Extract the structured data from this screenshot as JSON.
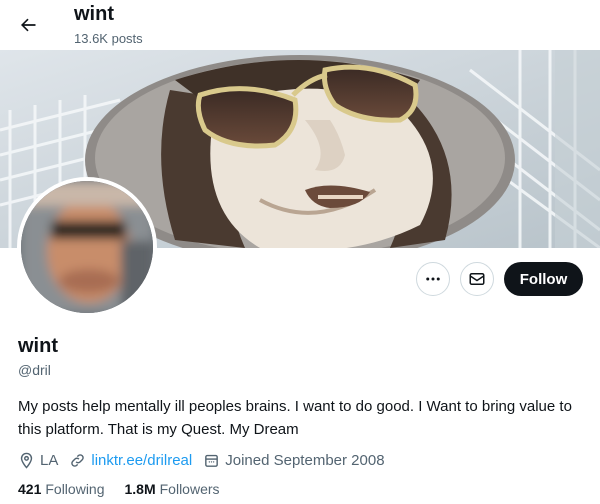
{
  "header": {
    "title": "wint",
    "subtitle": "13.6K posts",
    "back_icon": "arrow-left-icon"
  },
  "banner": {
    "description_icon": "cover-photo"
  },
  "profile": {
    "name": "wint",
    "handle": "@dril",
    "bio": "My posts help mentally ill peoples brains. I want to do good. I Want to bring value to this platform. That is my Quest. My Dream",
    "location": "LA",
    "link": "linktr.ee/drilreal",
    "joined": "Joined September 2008",
    "following_count": "421",
    "following_label": "Following",
    "followers_count": "1.8M",
    "followers_label": "Followers"
  },
  "actions": {
    "more_icon": "more-icon",
    "message_icon": "envelope-icon",
    "follow_label": "Follow"
  },
  "colors": {
    "link": "#1d9bf0",
    "muted": "#536471",
    "text": "#0f1419",
    "follow_bg": "#0f1419"
  }
}
